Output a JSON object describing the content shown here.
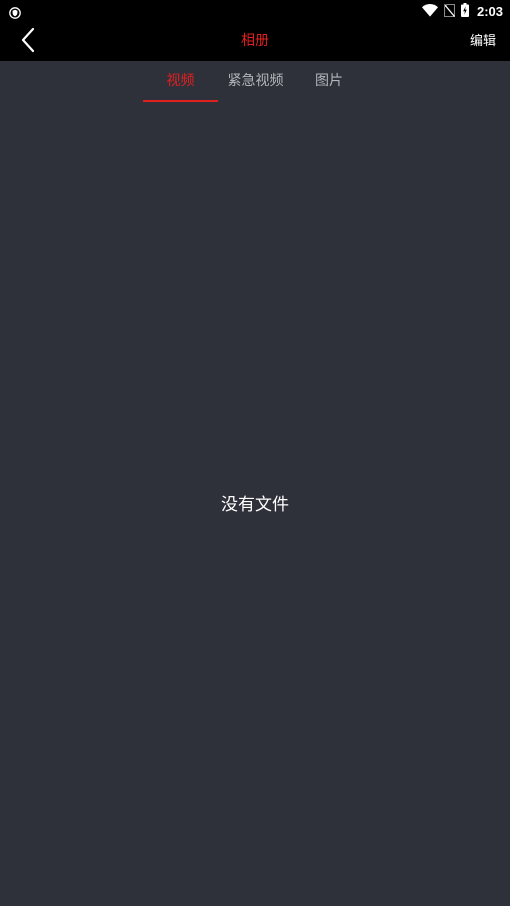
{
  "status_bar": {
    "time": "2:03",
    "left_icon": "shield-icon",
    "icons": [
      "wifi-icon",
      "no-sim-icon",
      "battery-charging-icon"
    ]
  },
  "header": {
    "title": "相册",
    "back_icon": "chevron-left-icon",
    "edit_label": "编辑"
  },
  "tabs": [
    {
      "label": "视频",
      "active": true
    },
    {
      "label": "紧急视频",
      "active": false
    },
    {
      "label": "图片",
      "active": false
    }
  ],
  "main": {
    "empty_text": "没有文件"
  },
  "colors": {
    "accent": "#e0201f",
    "background": "#2f313a",
    "bar": "#000000",
    "inactive_tab": "#b3b5bb"
  }
}
